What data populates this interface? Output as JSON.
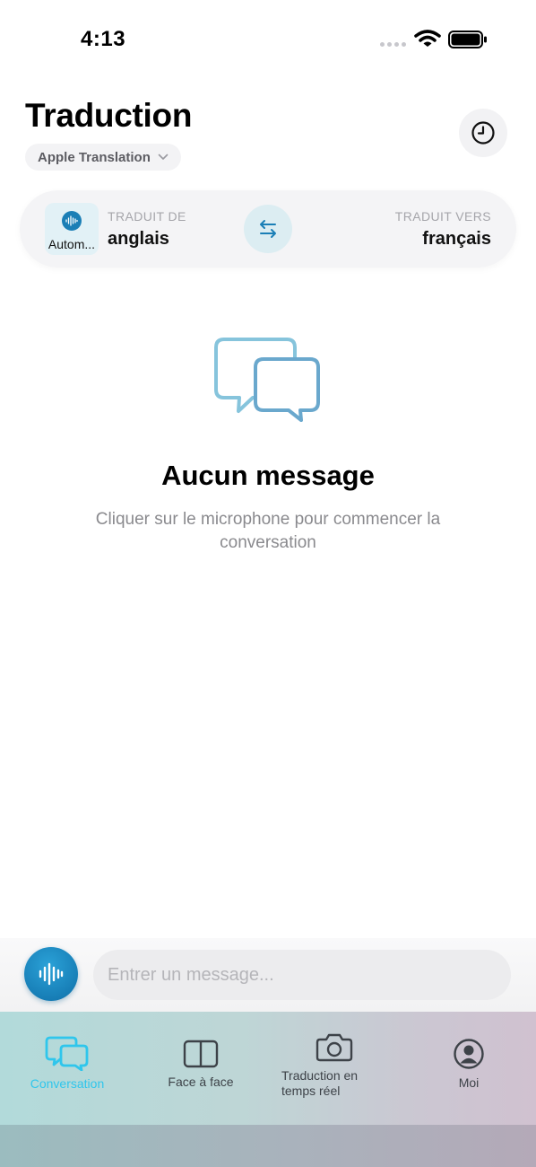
{
  "status_bar": {
    "time": "4:13"
  },
  "header": {
    "title": "Traduction",
    "engine": "Apple Translation",
    "history_icon": "clock-icon"
  },
  "language_bar": {
    "source_chip_label": "Autom...",
    "from_caption": "TRADUIT DE",
    "from_language": "anglais",
    "swap_icon": "swap-arrows-icon",
    "to_caption": "TRADUIT VERS",
    "to_language": "français"
  },
  "empty_state": {
    "icon": "chat-bubbles-icon",
    "title": "Aucun message",
    "subtitle": "Cliquer sur le microphone pour commencer la conversation"
  },
  "composer": {
    "mic_icon": "waveform-icon",
    "placeholder": "Entrer un message..."
  },
  "tabs": [
    {
      "label": "Conversation",
      "icon": "chat-bubbles-icon",
      "active": true
    },
    {
      "label": "Face à face",
      "icon": "split-view-icon",
      "active": false
    },
    {
      "label": "Traduction en temps réel",
      "icon": "camera-icon",
      "active": false
    },
    {
      "label": "Moi",
      "icon": "person-icon",
      "active": false
    }
  ],
  "colors": {
    "accent": "#2fc6ec",
    "primary_blue": "#1b7fb6",
    "icon_line": "#7db8d6"
  }
}
